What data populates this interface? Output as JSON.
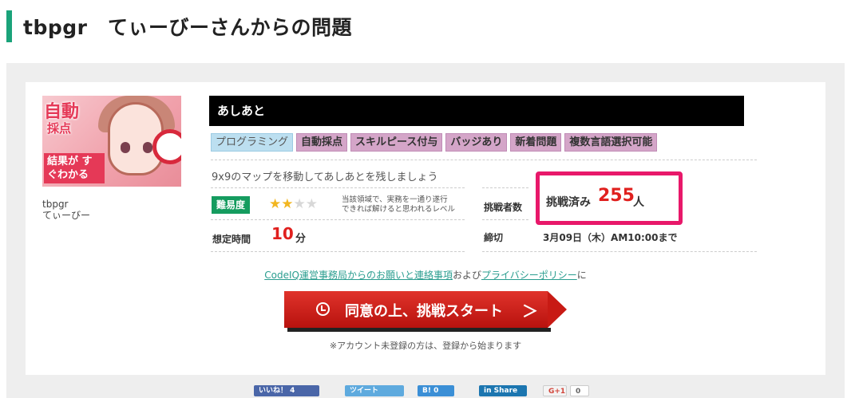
{
  "header": {
    "title": "tbpgr　てぃーびーさんからの問題",
    "accent_color": "#1aa37a"
  },
  "problem": {
    "thumbnail": {
      "line1": "自動",
      "line2": "採点",
      "line3": "結果が すぐわかる"
    },
    "author_id": "tbpgr",
    "author_name": "てぃーびー",
    "title": "あしあと",
    "tags": [
      "プログラミング",
      "自動採点",
      "スキルピース付与",
      "バッジあり",
      "新着問題",
      "複数言語選択可能"
    ],
    "description": "9x9のマップを移動してあしあとを残しましょう",
    "difficulty": {
      "label": "難易度",
      "stars_filled": 2,
      "stars_total": 5,
      "note_line1": "当該領域で、実務を一通り遂行",
      "note_line2": "できれば解けると思われるレベル"
    },
    "time": {
      "label": "想定時間",
      "value": "10",
      "unit": "分"
    },
    "challengers": {
      "label": "挑戦者数",
      "prefix": "挑戦済み",
      "count": "255",
      "unit": "人"
    },
    "deadline": {
      "label": "締切",
      "value": "3月09日（木）AM10:00まで"
    }
  },
  "links": {
    "link1": "CodeIQ運営事務局からのお願いと連絡事項",
    "mid": "および",
    "link2": "プライバシーポリシー",
    "end": "に"
  },
  "start_button": {
    "label": "同意の上、挑戦スタート",
    "chevron": "＞"
  },
  "note": "※アカウント未登録の方は、登録から始まります",
  "social": {
    "like": "いいね！ 4",
    "tweet": "ツイート",
    "hatena": "B! 0",
    "linkedin": "in Share",
    "gplus": "G+1",
    "gplus_count": "0"
  }
}
